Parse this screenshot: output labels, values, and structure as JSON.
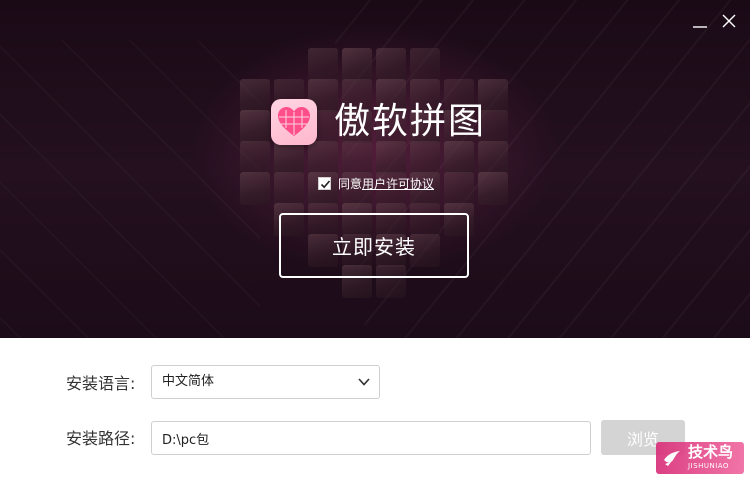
{
  "window": {
    "title": "傲软拼图",
    "minimize_icon": "minimize-icon",
    "close_icon": "close-icon"
  },
  "hero": {
    "agreement_prefix": "同意",
    "agreement_link": "用户许可协议",
    "agreement_checked": true,
    "install_label": "立即安装"
  },
  "settings": {
    "language_label": "安装语言:",
    "language_value": "中文简体",
    "path_label": "安装路径:",
    "path_value": "D:\\pc包",
    "browse_label": "浏览"
  },
  "watermark": {
    "title": "技术鸟",
    "subtitle": "JISHUNIAO"
  },
  "colors": {
    "hero_background": "#1f0d1a",
    "logo_pink": "#ff4f8b",
    "watermark_pink": "#e6418a",
    "browse_button": "#d4d4d4"
  }
}
